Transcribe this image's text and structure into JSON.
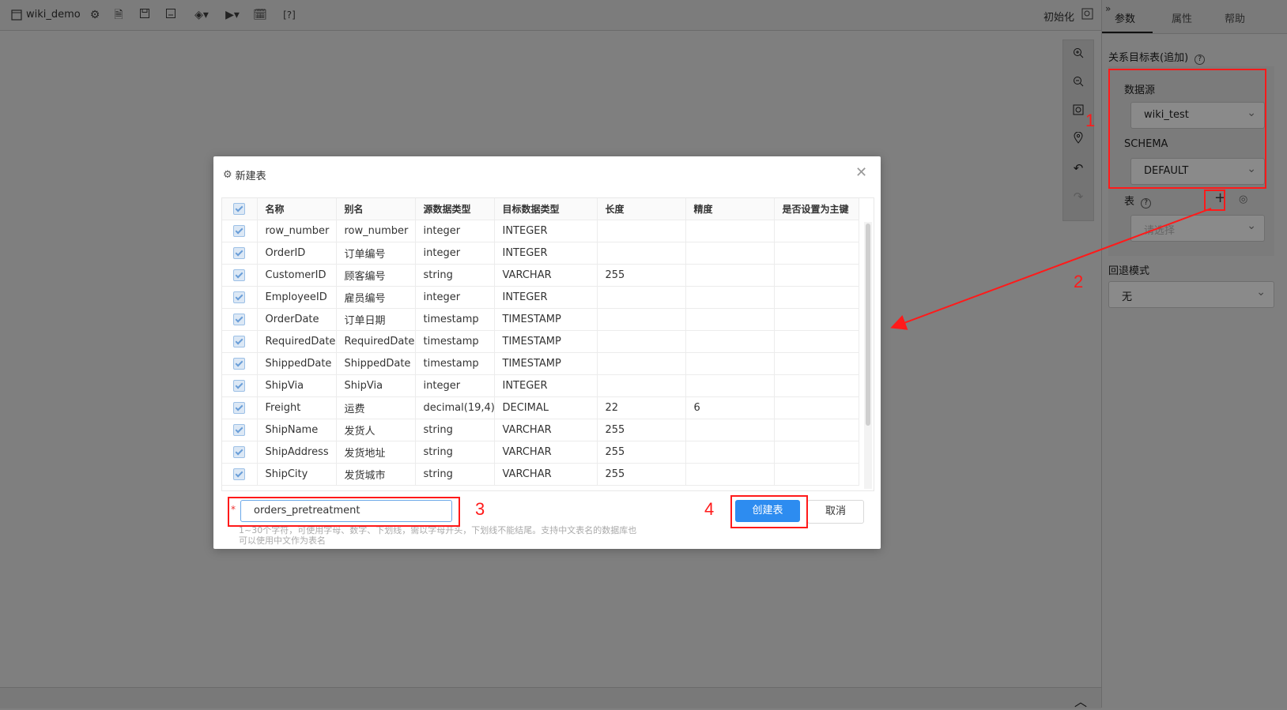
{
  "app": {
    "title": "wiki_demo",
    "init_label": "初始化"
  },
  "toolbar_icons": [
    "settings-icon",
    "document-icon",
    "save-icon",
    "save-as-icon",
    "publish-icon",
    "run-icon",
    "schedule-icon",
    "help-icon"
  ],
  "help_label": "[?]",
  "right_panel": {
    "tabs": [
      "参数",
      "属性",
      "帮助"
    ],
    "section_label": "关系目标表(追加)",
    "datasource_label": "数据源",
    "datasource_value": "wiki_test",
    "schema_label": "SCHEMA",
    "schema_value": "DEFAULT",
    "table_label": "表",
    "table_placeholder": "请选择",
    "fallback_label": "回退模式",
    "fallback_value": "无"
  },
  "dialog": {
    "title": "新建表",
    "columns": [
      "名称",
      "别名",
      "源数据类型",
      "目标数据类型",
      "长度",
      "精度",
      "是否设置为主键"
    ],
    "rows": [
      [
        "row_number",
        "row_number",
        "integer",
        "INTEGER",
        "",
        ""
      ],
      [
        "OrderID",
        "订单编号",
        "integer",
        "INTEGER",
        "",
        ""
      ],
      [
        "CustomerID",
        "顾客编号",
        "string",
        "VARCHAR",
        "255",
        ""
      ],
      [
        "EmployeeID",
        "雇员编号",
        "integer",
        "INTEGER",
        "",
        ""
      ],
      [
        "OrderDate",
        "订单日期",
        "timestamp",
        "TIMESTAMP",
        "",
        ""
      ],
      [
        "RequiredDate",
        "RequiredDate",
        "timestamp",
        "TIMESTAMP",
        "",
        ""
      ],
      [
        "ShippedDate",
        "ShippedDate",
        "timestamp",
        "TIMESTAMP",
        "",
        ""
      ],
      [
        "ShipVia",
        "ShipVia",
        "integer",
        "INTEGER",
        "",
        ""
      ],
      [
        "Freight",
        "运费",
        "decimal(19,4)",
        "DECIMAL",
        "22",
        "6"
      ],
      [
        "ShipName",
        "发货人",
        "string",
        "VARCHAR",
        "255",
        ""
      ],
      [
        "ShipAddress",
        "发货地址",
        "string",
        "VARCHAR",
        "255",
        ""
      ],
      [
        "ShipCity",
        "发货城市",
        "string",
        "VARCHAR",
        "255",
        ""
      ]
    ],
    "table_name_value": "orders_pretreatment",
    "required_mark": "*",
    "hint_line1": "1~30个字符，可使用字母、数字、下划线，需以字母开头，下划线不能结尾。支持中文表名的数据库也",
    "hint_line2": "可以使用中文作为表名",
    "create_label": "创建表",
    "cancel_label": "取消"
  },
  "annotations": {
    "n1": "1",
    "n2": "2",
    "n3": "3",
    "n4": "4",
    "color": "#ff1a1a"
  }
}
